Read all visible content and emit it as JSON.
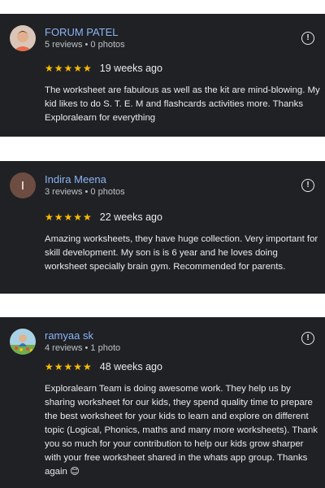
{
  "reviews": [
    {
      "name": "FORUM PATEL",
      "meta": "5 reviews • 0 photos",
      "stars": "★★★★★",
      "rating": 5,
      "time": "19 weeks ago",
      "text": "The worksheet are fabulous as well as the kit are mind-blowing. My kid likes to do S. T. E. M and flashcards activities more. Thanks Exploralearn for everything",
      "more_icon": "!"
    },
    {
      "name": "Indira Meena",
      "meta": "3 reviews • 0 photos",
      "avatar_letter": "I",
      "stars": "★★★★★",
      "rating": 5,
      "time": "22 weeks ago",
      "text": "Amazing worksheets, they have huge collection. Very important for skill development. My son is is 6 year and he loves doing worksheet specially brain gym. Recommended for parents.",
      "more_icon": "!"
    },
    {
      "name": "ramyaa sk",
      "meta": "4 reviews • 1 photo",
      "stars": "★★★★★",
      "rating": 5,
      "time": "48 weeks ago",
      "text": "Exploralearn Team is doing awesome work. They help us by sharing worksheet for our kids, they spend quality time to prepare the best worksheet for your kids to learn and explore on different topic (Logical, Phonics, maths and many more worksheets). Thank you so much for your contribution to help our kids grow sharper with your free worksheet shared in the whats app group. Thanks again 😊",
      "more_icon": "!"
    }
  ],
  "colors": {
    "card_bg": "#202124",
    "name": "#8ab4f8",
    "star": "#fbbc04",
    "text": "#e8eaed"
  }
}
